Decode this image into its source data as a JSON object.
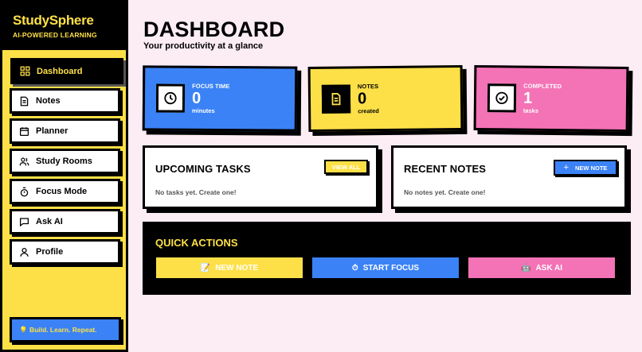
{
  "brand": {
    "title": "StudySphere",
    "subtitle": "AI-POWERED LEARNING"
  },
  "sidebar": {
    "items": [
      {
        "label": "Dashboard",
        "icon": "grid-icon",
        "active": true
      },
      {
        "label": "Notes",
        "icon": "document-icon"
      },
      {
        "label": "Planner",
        "icon": "calendar-icon"
      },
      {
        "label": "Study Rooms",
        "icon": "users-icon"
      },
      {
        "label": "Focus Mode",
        "icon": "timer-icon"
      },
      {
        "label": "Ask AI",
        "icon": "chat-icon"
      },
      {
        "label": "Profile",
        "icon": "user-icon"
      }
    ],
    "motto": "💡 Build. Learn. Repeat."
  },
  "header": {
    "title": "DASHBOARD",
    "subtitle": "Your productivity at a glance"
  },
  "stats": [
    {
      "label": "FOCUS TIME",
      "value": "0",
      "unit": "minutes",
      "icon": "clock-icon",
      "color": "#3b82f6"
    },
    {
      "label": "NOTES",
      "value": "0",
      "unit": "created",
      "icon": "document-icon",
      "color": "#fde047"
    },
    {
      "label": "COMPLETED",
      "value": "1",
      "unit": "tasks",
      "icon": "check-circle-icon",
      "color": "#f472b6"
    }
  ],
  "upcoming_tasks": {
    "title": "UPCOMING TASKS",
    "button": "VIEW ALL",
    "empty": "No tasks yet. Create one!"
  },
  "recent_notes": {
    "title": "RECENT NOTES",
    "button": "NEW NOTE",
    "empty": "No notes yet. Create one!"
  },
  "quick_actions": {
    "title": "QUICK ACTIONS",
    "buttons": [
      {
        "emoji": "📝",
        "label": "NEW NOTE",
        "color": "#fde047"
      },
      {
        "emoji": "⏱",
        "label": "START FOCUS",
        "color": "#3b82f6"
      },
      {
        "emoji": "🤖",
        "label": "ASK AI",
        "color": "#f472b6"
      }
    ]
  },
  "colors": {
    "accent_yellow": "#fde047",
    "accent_blue": "#3b82f6",
    "accent_pink": "#f472b6",
    "background": "#fcecf4"
  }
}
